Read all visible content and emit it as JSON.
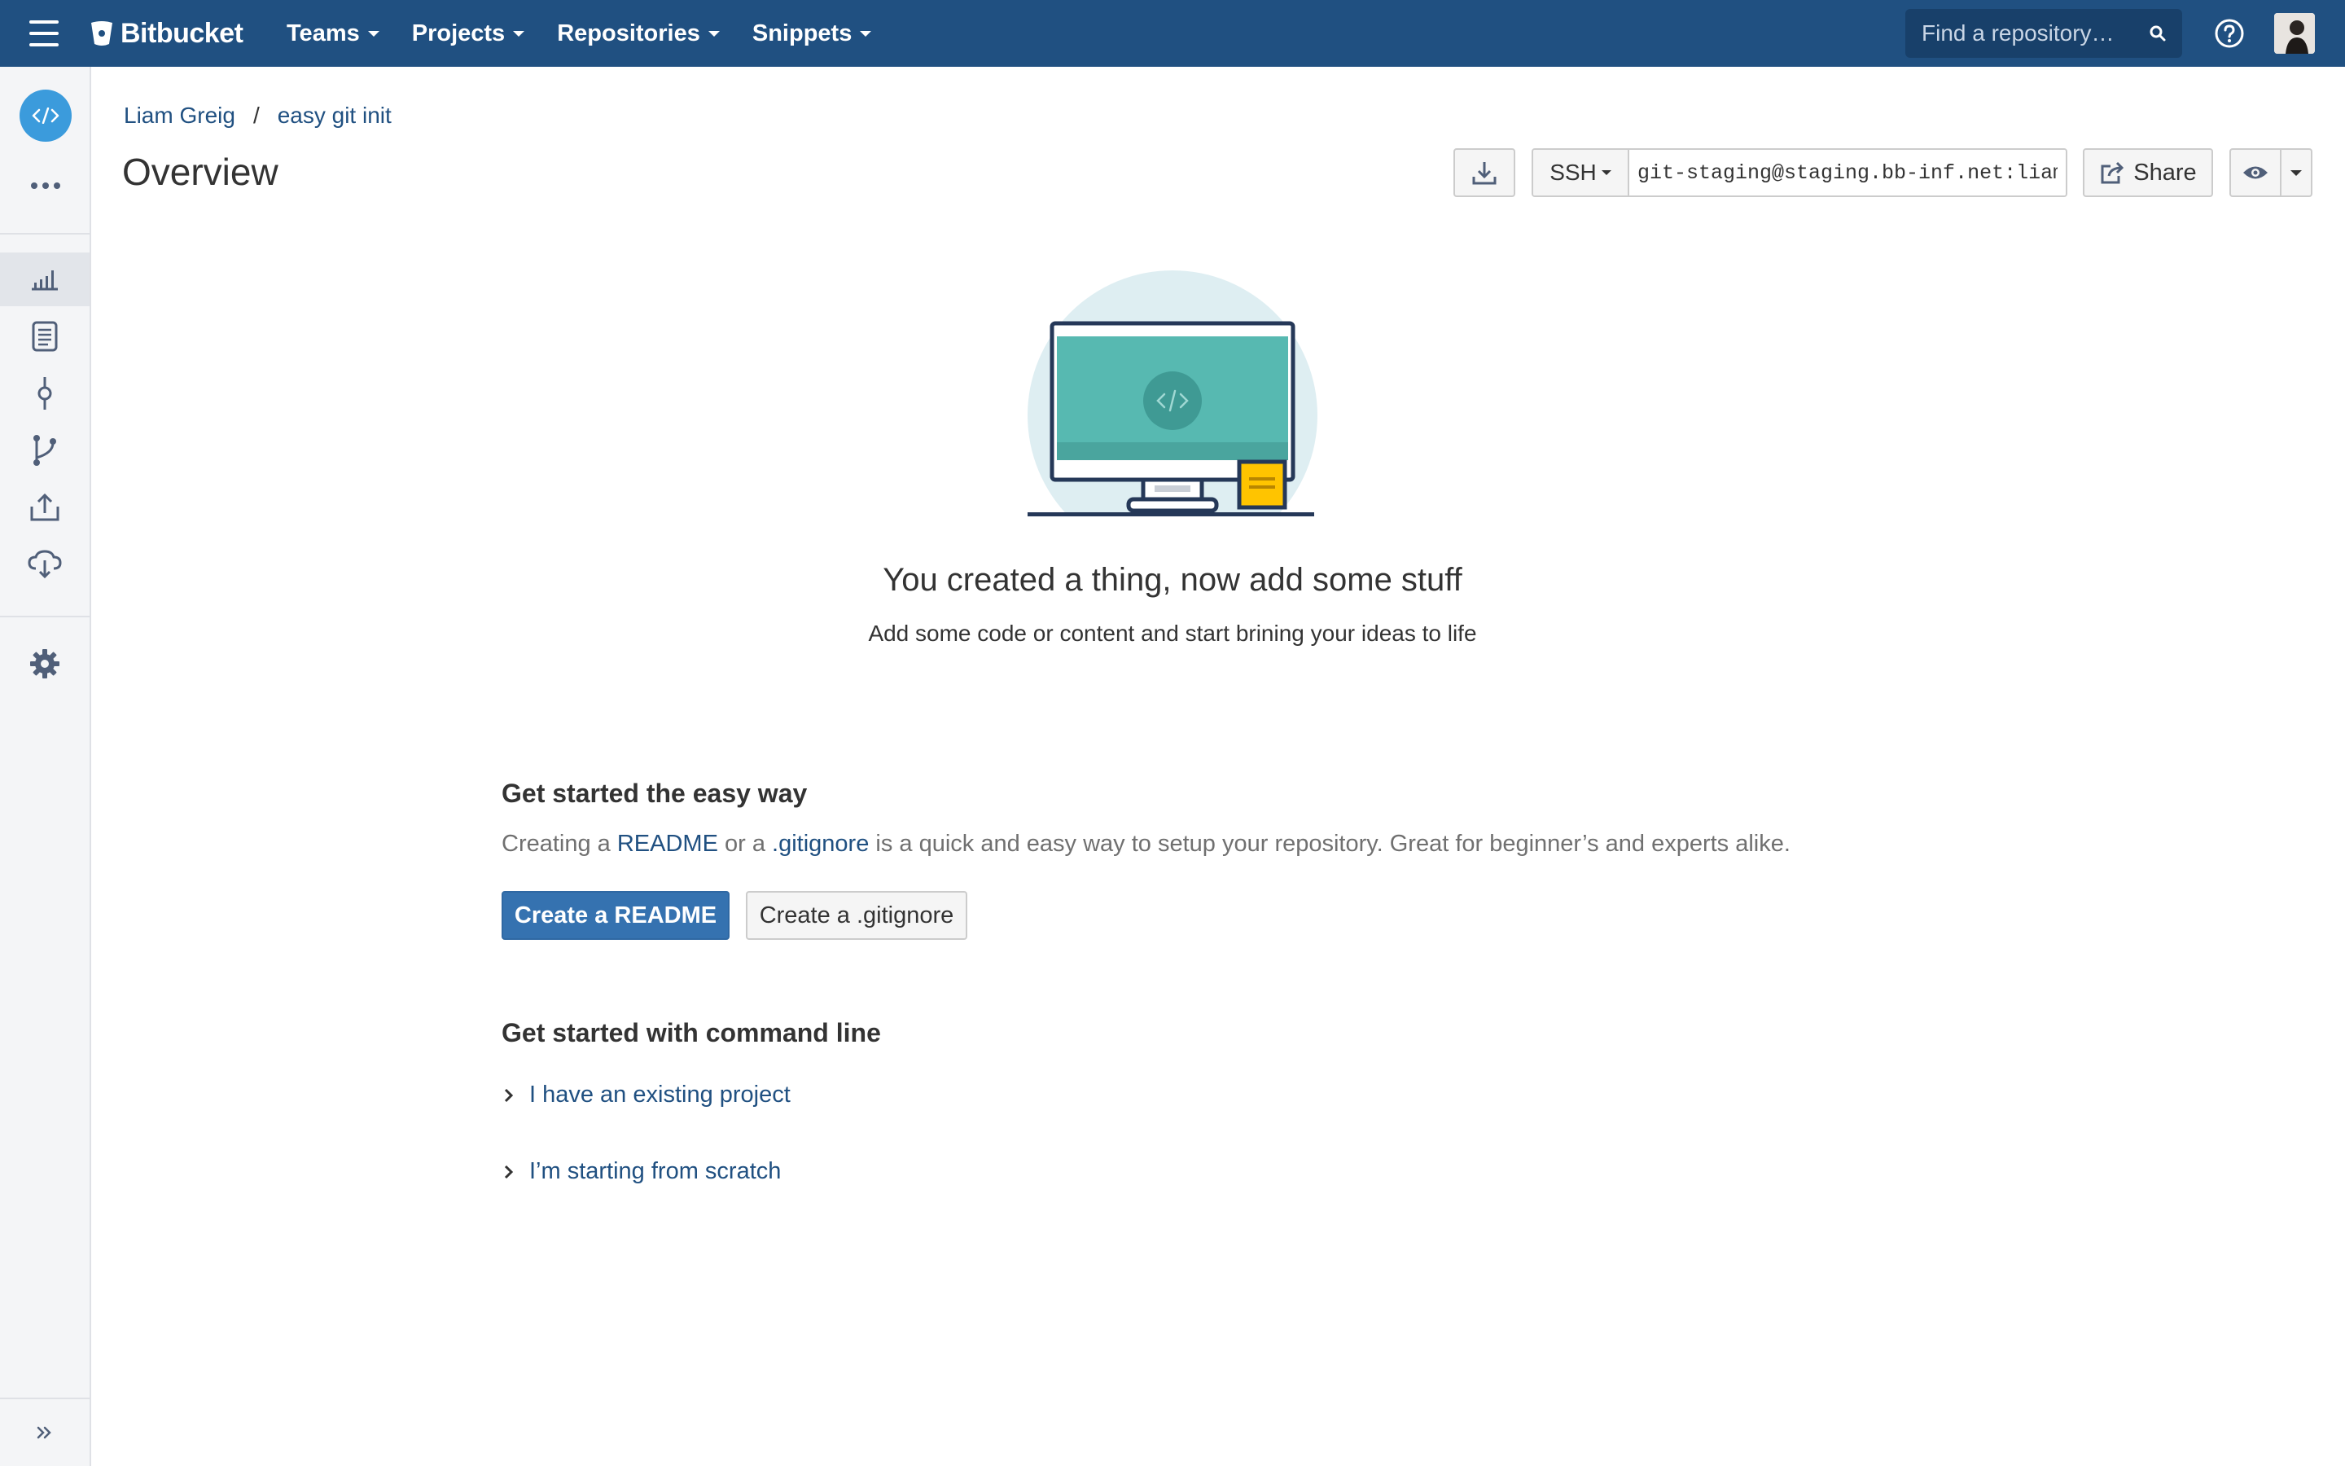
{
  "topbar": {
    "brand": "Bitbucket",
    "nav": [
      {
        "label": "Teams"
      },
      {
        "label": "Projects"
      },
      {
        "label": "Repositories"
      },
      {
        "label": "Snippets"
      }
    ],
    "search_placeholder": "Find a repository…"
  },
  "breadcrumb": {
    "owner": "Liam Greig",
    "separator": "/",
    "repo": "easy git init"
  },
  "page_title": "Overview",
  "clone": {
    "protocol": "SSH",
    "url": "git-staging@staging.bb-inf.net:liam_"
  },
  "share_label": "Share",
  "empty_state": {
    "title": "You created a thing, now add some stuff",
    "subtitle": "Add some code or content and start brining your ideas to life"
  },
  "easy_way": {
    "title": "Get started the easy way",
    "desc_prefix": "Creating a ",
    "readme_link": "README",
    "desc_middle": " or a ",
    "gitignore_link": ".gitignore",
    "desc_suffix": " is a quick and easy way to setup your repository. Great for beginner’s and experts alike.",
    "create_readme": "Create a README",
    "create_gitignore": "Create a .gitignore"
  },
  "command_line": {
    "title": "Get started with command line",
    "existing": "I have an existing project",
    "scratch": "I’m starting from scratch"
  },
  "colors": {
    "header": "#205081",
    "link": "#205081",
    "primary_button": "#3572b0",
    "repo_avatar": "#3b9bdc"
  },
  "icons": {
    "sidebar": [
      "overview-icon",
      "source-icon",
      "commits-icon",
      "branches-icon",
      "pull-requests-icon",
      "pipelines-icon",
      "settings-icon"
    ]
  }
}
